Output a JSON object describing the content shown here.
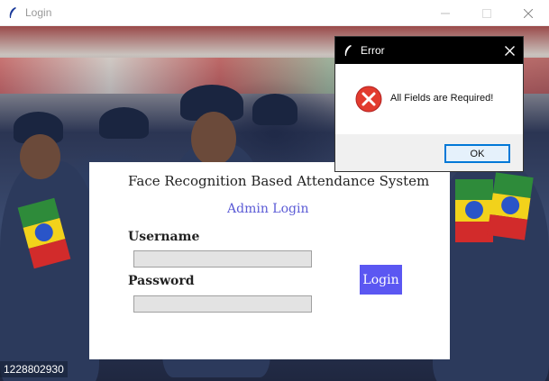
{
  "window": {
    "title": "Login",
    "icon": "feather-icon"
  },
  "background": {
    "overlay_text": "1228802930"
  },
  "login_panel": {
    "app_title": "Face Recognition Based Attendance System",
    "subtitle": "Admin Login",
    "username_label": "Username",
    "username_value": "",
    "password_label": "Password",
    "password_value": "",
    "login_button": "Login",
    "accent_color": "#5b57f2"
  },
  "error_dialog": {
    "title": "Error",
    "message": "All Fields are Required!",
    "ok_button": "OK",
    "icon": "error-icon"
  }
}
